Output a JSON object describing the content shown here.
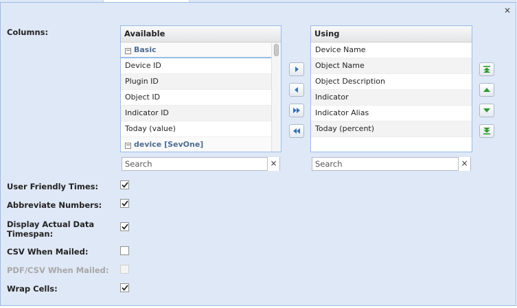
{
  "dialog": {
    "close_label": "×"
  },
  "columns_label": "Columns:",
  "available": {
    "header": "Available",
    "rows": [
      {
        "type": "group",
        "label": "Basic"
      },
      {
        "type": "item",
        "label": "Device ID"
      },
      {
        "type": "item",
        "label": "Plugin ID"
      },
      {
        "type": "item",
        "label": "Object ID"
      },
      {
        "type": "item",
        "label": "Indicator ID"
      },
      {
        "type": "item",
        "label": "Today (value)"
      },
      {
        "type": "group",
        "label": "device [SevOne]"
      }
    ],
    "search_placeholder": "Search",
    "clear_label": "×"
  },
  "using": {
    "header": "Using",
    "rows": [
      {
        "type": "item",
        "label": "Device Name"
      },
      {
        "type": "item",
        "label": "Object Name"
      },
      {
        "type": "item",
        "label": "Object Description"
      },
      {
        "type": "item",
        "label": "Indicator"
      },
      {
        "type": "item",
        "label": "Indicator Alias"
      },
      {
        "type": "item",
        "label": "Today (percent)"
      }
    ],
    "search_placeholder": "Search",
    "clear_label": "×"
  },
  "group_toggle": "−",
  "options": [
    {
      "key": "user_friendly_times",
      "label": "User Friendly Times:",
      "checked": true,
      "disabled": false
    },
    {
      "key": "abbreviate_numbers",
      "label": "Abbreviate Numbers:",
      "checked": true,
      "disabled": false
    },
    {
      "key": "display_actual_data_timespan",
      "label": "Display Actual Data Timespan:",
      "checked": true,
      "disabled": false
    },
    {
      "key": "csv_when_mailed",
      "label": "CSV When Mailed:",
      "checked": false,
      "disabled": false
    },
    {
      "key": "pdf_csv_when_mailed",
      "label": "PDF/CSV When Mailed:",
      "checked": false,
      "disabled": true
    },
    {
      "key": "wrap_cells",
      "label": "Wrap Cells:",
      "checked": true,
      "disabled": false
    }
  ],
  "icons": {
    "move_right": "arrow-right-icon",
    "move_left": "arrow-left-icon",
    "move_all_right": "double-arrow-right-icon",
    "move_all_left": "double-arrow-left-icon",
    "move_top": "move-to-top-icon",
    "move_up": "move-up-icon",
    "move_down": "move-down-icon",
    "move_bottom": "move-to-bottom-icon"
  },
  "colors": {
    "dialog_bg": "#dfe8f6",
    "border": "#99bbe8",
    "transfer_arrow": "#3a6fb0",
    "order_arrow": "#2e9a2e",
    "group_text": "#4d6b93"
  }
}
